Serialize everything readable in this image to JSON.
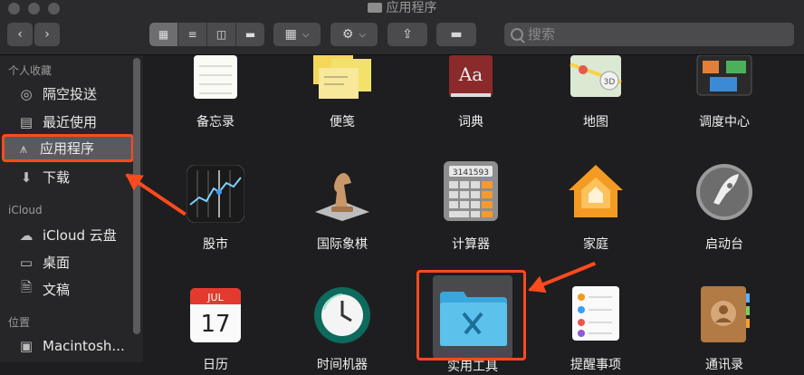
{
  "window": {
    "title": "应用程序"
  },
  "toolbar": {
    "search_placeholder": "搜索",
    "back_icon": "chevron-left",
    "forward_icon": "chevron-right"
  },
  "sidebar": {
    "favorites_header": "个人收藏",
    "icloud_header": "iCloud",
    "locations_header": "位置",
    "items": [
      {
        "label": "隔空投送",
        "icon": "airdrop-icon"
      },
      {
        "label": "最近使用",
        "icon": "recents-icon"
      },
      {
        "label": "应用程序",
        "icon": "applications-icon"
      },
      {
        "label": "下载",
        "icon": "downloads-icon"
      },
      {
        "label": "iCloud 云盘",
        "icon": "cloud-icon"
      },
      {
        "label": "桌面",
        "icon": "desktop-icon"
      },
      {
        "label": "文稿",
        "icon": "documents-icon"
      },
      {
        "label": "Macintosh...",
        "icon": "disk-icon"
      }
    ]
  },
  "apps": [
    {
      "label": "备忘录",
      "icon": "notes-icon"
    },
    {
      "label": "便笺",
      "icon": "stickies-icon"
    },
    {
      "label": "词典",
      "icon": "dictionary-icon"
    },
    {
      "label": "地图",
      "icon": "maps-icon"
    },
    {
      "label": "调度中心",
      "icon": "mission-control-icon"
    },
    {
      "label": "股市",
      "icon": "stocks-icon"
    },
    {
      "label": "国际象棋",
      "icon": "chess-icon"
    },
    {
      "label": "计算器",
      "icon": "calculator-icon"
    },
    {
      "label": "家庭",
      "icon": "home-icon"
    },
    {
      "label": "启动台",
      "icon": "launchpad-icon"
    },
    {
      "label": "日历",
      "icon": "calendar-icon"
    },
    {
      "label": "时间机器",
      "icon": "time-machine-icon"
    },
    {
      "label": "实用工具",
      "icon": "utilities-folder-icon"
    },
    {
      "label": "提醒事项",
      "icon": "reminders-icon"
    },
    {
      "label": "通讯录",
      "icon": "contacts-icon"
    }
  ],
  "calendar": {
    "month": "JUL",
    "day": "17"
  },
  "calculator": {
    "display": "3141593"
  },
  "dictionary": {
    "glyph": "Aa"
  },
  "maps": {
    "badge": "3D"
  },
  "colors": {
    "accent": "#ff4a1e",
    "sidebar": "#262628",
    "background": "#1e1e20"
  }
}
